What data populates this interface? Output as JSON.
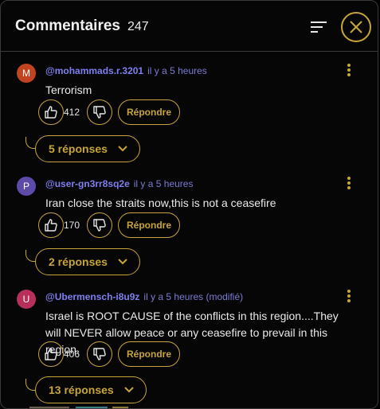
{
  "header": {
    "title": "Commentaires",
    "count": "247"
  },
  "comments": [
    {
      "initial": "M",
      "avatar_color": "#c2441e",
      "handle": "@mohammads.r.3201",
      "time": "il y a 5 heures",
      "text": "Terrorism",
      "likes": "412",
      "reply_label": "Répondre",
      "replies_label": "5 réponses"
    },
    {
      "initial": "P",
      "avatar_color": "#5e4aa8",
      "handle": "@user-gn3rr8sq2e",
      "time": "il y a 5 heures",
      "text": "Iran close the straits now,this is not a ceasefire",
      "likes": "170",
      "reply_label": "Répondre",
      "replies_label": "2 réponses"
    },
    {
      "initial": "U",
      "avatar_color": "#b8305a",
      "handle": "@Ubermensch-i8u9z",
      "time": "il y a 5 heures (modifié)",
      "text": "Israel is ROOT CAUSE of the conflicts in this region....They will NEVER allow peace or any ceasefire to prevail in this region.",
      "likes": "406",
      "reply_label": "Répondre",
      "replies_label": "13 réponses"
    }
  ],
  "colors": {
    "accent": "#c7a53b",
    "handle": "#7f7ff0",
    "background": "#000000"
  }
}
